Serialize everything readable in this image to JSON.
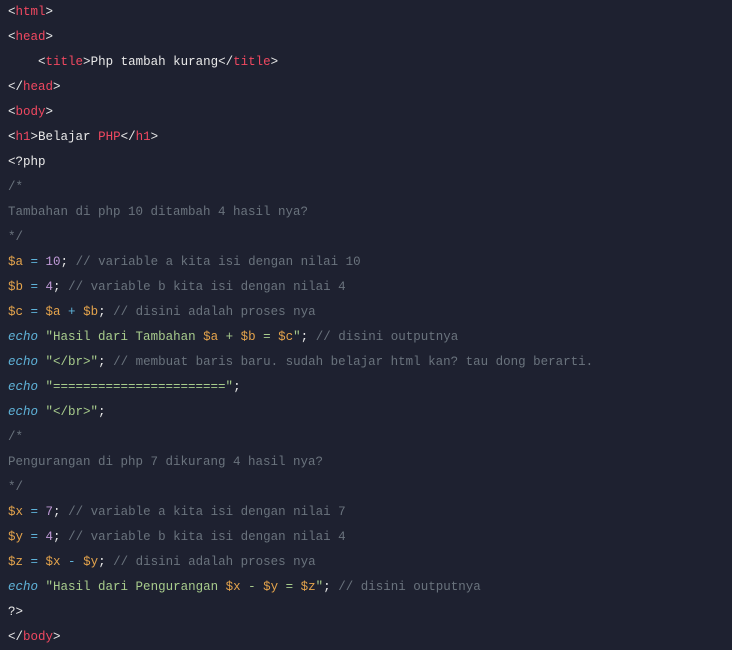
{
  "lines": {
    "l1_open": "<",
    "l1_html": "html",
    "l1_close": ">",
    "l2_open": "<",
    "l2_head": "head",
    "l2_close": ">",
    "l3_indent": "    ",
    "l3_open": "<",
    "l3_title": "title",
    "l3_close1": ">",
    "l3_text": "Php tambah kurang",
    "l3_open2": "</",
    "l3_title2": "title",
    "l3_close2": ">",
    "l4_open": "</",
    "l4_head": "head",
    "l4_close": ">",
    "l5_open": "<",
    "l5_body": "body",
    "l5_close": ">",
    "l6_open": "<",
    "l6_h1": "h1",
    "l6_close1": ">",
    "l6_text1": "Belajar ",
    "l6_text2": "PHP",
    "l6_open2": "</",
    "l6_h1b": "h1",
    "l6_close2": ">",
    "l7": "<?php",
    "l8": "/*",
    "l9": "Tambahan di php 10 ditambah 4 hasil nya?",
    "l10": "*/",
    "l11_var": "$a",
    "l11_eq": " = ",
    "l11_num": "10",
    "l11_semi": ";",
    "l11_c": " // variable a kita isi dengan nilai 10",
    "l12_var": "$b",
    "l12_eq": " = ",
    "l12_num": "4",
    "l12_semi": ";",
    "l12_c": " // variable b kita isi dengan nilai 4",
    "l13_var": "$c",
    "l13_eq": " = ",
    "l13_a": "$a",
    "l13_op": " + ",
    "l13_b": "$b",
    "l13_semi": ";",
    "l13_c": " // disini adalah proses nya",
    "l14_echo": "echo",
    "l14_sp": " ",
    "l14_q1": "\"",
    "l14_s1": "Hasil dari Tambahan ",
    "l14_v1": "$a",
    "l14_s2": " + ",
    "l14_v2": "$b",
    "l14_s3": " = ",
    "l14_v3": "$c",
    "l14_q2": "\"",
    "l14_semi": ";",
    "l14_c": " // disini outputnya",
    "l15_echo": "echo",
    "l15_sp": " ",
    "l15_str": "\"</br>\"",
    "l15_semi": ";",
    "l15_c": " // membuat baris baru. sudah belajar html kan? tau dong berarti.",
    "l16_echo": "echo",
    "l16_sp": " ",
    "l16_str": "\"=======================\"",
    "l16_semi": ";",
    "l17_echo": "echo",
    "l17_sp": " ",
    "l17_str": "\"</br>\"",
    "l17_semi": ";",
    "l18": "/*",
    "l19": "Pengurangan di php 7 dikurang 4 hasil nya?",
    "l20": "*/",
    "l21_var": "$x",
    "l21_eq": " = ",
    "l21_num": "7",
    "l21_semi": ";",
    "l21_c": " // variable a kita isi dengan nilai 7",
    "l22_var": "$y",
    "l22_eq": " = ",
    "l22_num": "4",
    "l22_semi": ";",
    "l22_c": " // variable b kita isi dengan nilai 4",
    "l23_var": "$z",
    "l23_eq": " = ",
    "l23_a": "$x",
    "l23_op": " - ",
    "l23_b": "$y",
    "l23_semi": ";",
    "l23_c": " // disini adalah proses nya",
    "l24_echo": "echo",
    "l24_sp": " ",
    "l24_q1": "\"",
    "l24_s1": "Hasil dari Pengurangan ",
    "l24_v1": "$x",
    "l24_s2": " - ",
    "l24_v2": "$y",
    "l24_s3": " = ",
    "l24_v3": "$z",
    "l24_q2": "\"",
    "l24_semi": ";",
    "l24_c": " // disini outputnya",
    "l25": "?>",
    "l26_open": "</",
    "l26_body": "body",
    "l26_close": ">"
  }
}
